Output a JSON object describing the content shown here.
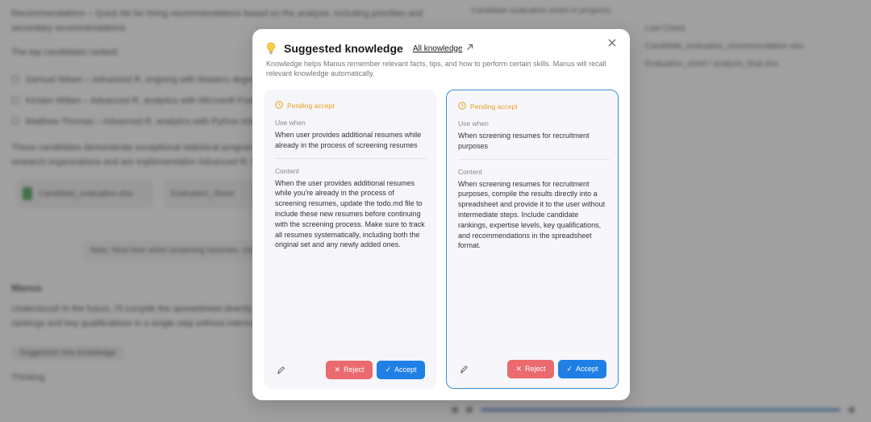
{
  "background": {
    "left_paragraph_1": "Recommendations – Quick list for hiring recommendations based on the analysis, including priorities and secondary recommendations",
    "left_heading_short": "The top candidates ranked:",
    "left_list": [
      "Samuel Nilsen – Advanced R, ongoing with Masters degree",
      "Kirsten Witten – Advanced R, analytics with Microsoft Power BI",
      "Matthew Thomas – Advanced R, analytics with Python integration"
    ],
    "left_paragraph_2": "These candidates demonstrate exceptional statistical programming skills and relevant experience in research organizations and are implementation Advanced R, Python, SQL.",
    "left_files": [
      "Candidate_evaluation.xlsx",
      "Evaluation_Sheet"
    ],
    "left_note": "Note: Next time when screening resumes, compile...",
    "left_section_heading": "Manus",
    "left_paragraph_3": "Understood! In the future, I'll compile the spreadsheet directly and provide the final results with candidate rankings and key qualifications in a single step without intermediate steps. Thank you for your feedback.",
    "left_pill": "Suggested new knowledge",
    "left_status": "Thinking",
    "right_rows": [
      "Candidate evaluation sheet in progress",
      "Last Check",
      "Candidate_evaluation_recommendation.xlsx",
      "Evaluation_sheet / analysis_final.xlsx"
    ]
  },
  "modal": {
    "title": "Suggested knowledge",
    "all_knowledge_label": "All knowledge",
    "description": "Knowledge helps Manus remember relevant facts, tips, and how to perform certain skills. Manus will recall relevant knowledge automatically.",
    "cards": [
      {
        "status": "Pending accept",
        "use_when_label": "Use when",
        "use_when": "When user provides additional resumes while already in the process of screening resumes",
        "content_label": "Content",
        "content": "When the user provides additional resumes while you're already in the process of screening resumes, update the todo.md file to include these new resumes before continuing with the screening process. Make sure to track all resumes systematically, including both the original set and any newly added ones.",
        "reject_label": "Reject",
        "accept_label": "Accept"
      },
      {
        "status": "Pending accept",
        "use_when_label": "Use when",
        "use_when": "When screening resumes for recruitment purposes",
        "content_label": "Content",
        "content": "When screening resumes for recruitment purposes, compile the results directly into a spreadsheet and provide it to the user without intermediate steps. Include candidate rankings, expertise levels, key qualifications, and recommendations in the spreadsheet format.",
        "reject_label": "Reject",
        "accept_label": "Accept"
      }
    ]
  },
  "colors": {
    "pending": "#e4a020",
    "reject": "#ea6a6e",
    "accept": "#1f7fe5",
    "selected_border": "#3a8fd8"
  },
  "icons": {
    "title": "lightbulb-icon",
    "link": "arrow-up-right-icon",
    "close": "close-icon",
    "status": "clock-icon",
    "edit": "pencil-icon",
    "reject": "x-icon",
    "accept": "check-icon"
  }
}
